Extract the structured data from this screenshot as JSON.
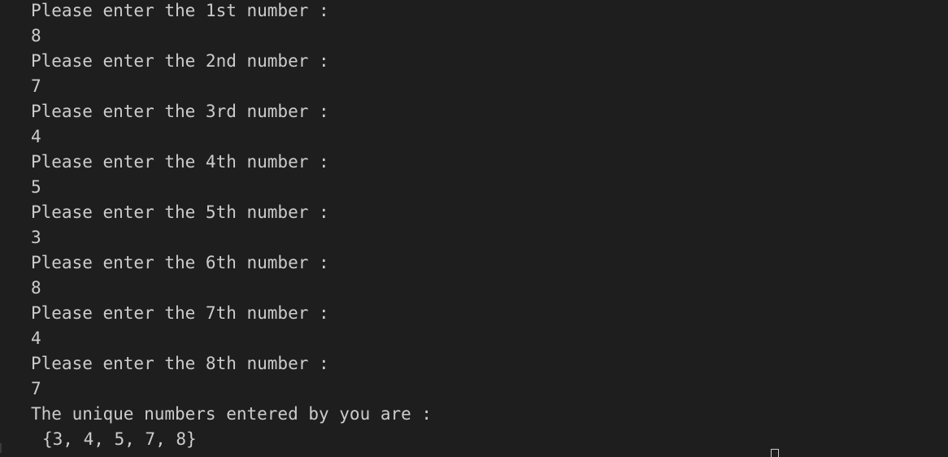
{
  "terminal": {
    "lines": [
      "Please enter the 1st number :",
      "8",
      "Please enter the 2nd number :",
      "7",
      "Please enter the 3rd number :",
      "4",
      "Please enter the 4th number :",
      "5",
      "Please enter the 5th number :",
      "3",
      "Please enter the 6th number :",
      "8",
      "Please enter the 7th number :",
      "4",
      "Please enter the 8th number :",
      "7",
      "The unique numbers entered by you are :",
      "{3, 4, 5, 7, 8}"
    ]
  }
}
